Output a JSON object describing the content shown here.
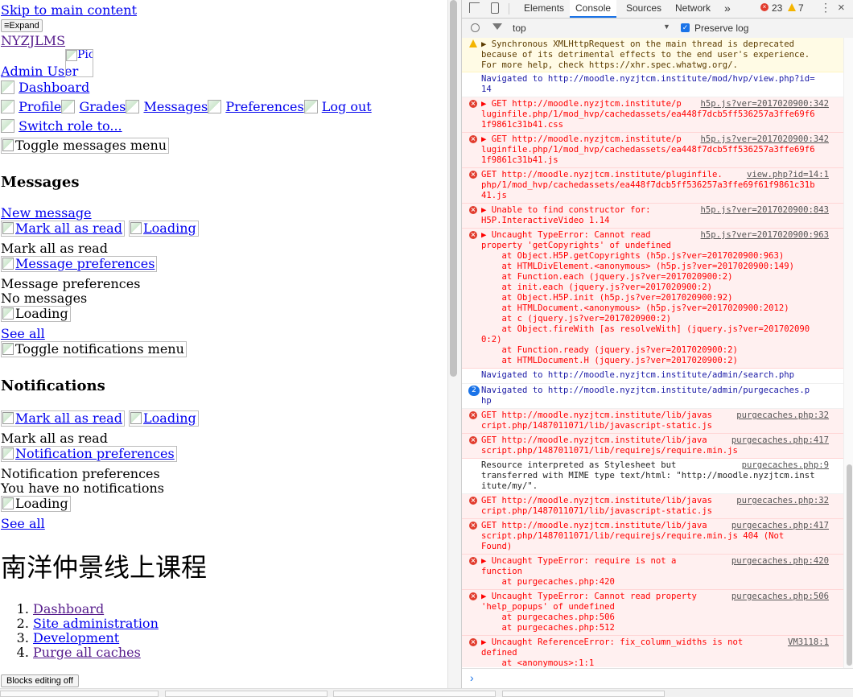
{
  "page": {
    "skip_link": "Skip to main content",
    "expand_button": "Expand",
    "site_name": "NYZJLMS",
    "user_name": "Admin User",
    "user_picture_alt": "Picture of",
    "nav": {
      "dashboard": "Dashboard",
      "profile": "Profile",
      "grades": "Grades",
      "messages": "Messages",
      "preferences": "Preferences",
      "logout": "Log out",
      "switch_role": "Switch role to..."
    },
    "toggle_messages": "Toggle messages menu",
    "messages": {
      "heading": "Messages",
      "new_message": "New message",
      "mark_all_read": "Mark all as read",
      "loading": "Loading",
      "mark_all_read_text": "Mark all as read",
      "message_preferences": "Message preferences",
      "message_preferences_text": "Message preferences",
      "no_messages": "No messages",
      "loading2": "Loading",
      "see_all": "See all"
    },
    "toggle_notifications": "Toggle notifications menu",
    "notifications": {
      "heading": "Notifications",
      "mark_all_read": "Mark all as read",
      "loading": "Loading",
      "mark_all_read_text": "Mark all as read",
      "notification_preferences": "Notification preferences",
      "notification_preferences_text": "Notification preferences",
      "no_notifications": "You have no notifications",
      "loading2": "Loading",
      "see_all": "See all"
    },
    "course_title": "南洋仲景线上课程",
    "breadcrumb": [
      "Dashboard",
      "Site administration",
      "Development",
      "Purge all caches"
    ],
    "blocks_editing": "Blocks editing off"
  },
  "devtools": {
    "tabs": [
      "Elements",
      "Console",
      "Sources",
      "Network"
    ],
    "more_tabs": "»",
    "error_count": "23",
    "warning_count": "7",
    "context": "top",
    "preserve_log": "Preserve log",
    "colors": {
      "accent": "#1a73e8",
      "error": "#ff0000",
      "error_bg": "#fff0f0",
      "warn_bg": "#fffbe5"
    },
    "messages": [
      {
        "kind": "warn",
        "text": "▶ Synchronous XMLHttpRequest on the main thread is deprecated\nbecause of its detrimental effects to the end user's experience.\nFor more help, check https://xhr.spec.whatwg.org/.",
        "src": ""
      },
      {
        "kind": "info",
        "text": "Navigated to http://moodle.nyzjtcm.institute/mod/hvp/view.php?id=\n14",
        "src": ""
      },
      {
        "kind": "err",
        "text": "▶ GET http://moodle.nyzjtcm.institute/p\nluginfile.php/1/mod_hvp/cachedassets/ea448f7dcb5ff536257a3ffe69f6\n1f9861c31b41.css",
        "src": "h5p.js?ver=2017020900:342"
      },
      {
        "kind": "err",
        "text": "▶ GET http://moodle.nyzjtcm.institute/p\nluginfile.php/1/mod_hvp/cachedassets/ea448f7dcb5ff536257a3ffe69f6\n1f9861c31b41.js",
        "src": "h5p.js?ver=2017020900:342"
      },
      {
        "kind": "err",
        "text": "GET http://moodle.nyzjtcm.institute/pluginfile.\nphp/1/mod_hvp/cachedassets/ea448f7dcb5ff536257a3ffe69f61f9861c31b\n41.js",
        "src": "view.php?id=14:1"
      },
      {
        "kind": "err",
        "text": "▶ Unable to find constructor for:\nH5P.InteractiveVideo 1.14",
        "src": "h5p.js?ver=2017020900:843"
      },
      {
        "kind": "err",
        "text": "▶ Uncaught TypeError: Cannot read\nproperty 'getCopyrights' of undefined\n    at Object.H5P.getCopyrights (h5p.js?ver=2017020900:963)\n    at HTMLDivElement.<anonymous> (h5p.js?ver=2017020900:149)\n    at Function.each (jquery.js?ver=2017020900:2)\n    at init.each (jquery.js?ver=2017020900:2)\n    at Object.H5P.init (h5p.js?ver=2017020900:92)\n    at HTMLDocument.<anonymous> (h5p.js?ver=2017020900:2012)\n    at c (jquery.js?ver=2017020900:2)\n    at Object.fireWith [as resolveWith] (jquery.js?ver=201702090\n0:2)\n    at Function.ready (jquery.js?ver=2017020900:2)\n    at HTMLDocument.H (jquery.js?ver=2017020900:2)",
        "src": "h5p.js?ver=2017020900:963"
      },
      {
        "kind": "info",
        "text": "Navigated to http://moodle.nyzjtcm.institute/admin/search.php",
        "src": ""
      },
      {
        "kind": "info",
        "count": "2",
        "text": "Navigated to http://moodle.nyzjtcm.institute/admin/purgecaches.p\nhp",
        "src": ""
      },
      {
        "kind": "err",
        "text": "GET http://moodle.nyzjtcm.institute/lib/javas\ncript.php/1487011071/lib/javascript-static.js",
        "src": "purgecaches.php:32"
      },
      {
        "kind": "err",
        "text": "GET http://moodle.nyzjtcm.institute/lib/java\nscript.php/1487011071/lib/requirejs/require.min.js",
        "src": "purgecaches.php:417"
      },
      {
        "kind": "plain",
        "text": "Resource interpreted as Stylesheet but\ntransferred with MIME type text/html: \"http://moodle.nyzjtcm.inst\nitute/my/\".",
        "src": "purgecaches.php:9"
      },
      {
        "kind": "err",
        "text": "GET http://moodle.nyzjtcm.institute/lib/javas\ncript.php/1487011071/lib/javascript-static.js",
        "src": "purgecaches.php:32"
      },
      {
        "kind": "err",
        "text": "GET http://moodle.nyzjtcm.institute/lib/java\nscript.php/1487011071/lib/requirejs/require.min.js 404 (Not\nFound)",
        "src": "purgecaches.php:417"
      },
      {
        "kind": "err",
        "text": "▶ Uncaught TypeError: require is not a\nfunction\n    at purgecaches.php:420",
        "src": "purgecaches.php:420"
      },
      {
        "kind": "err",
        "text": "▶ Uncaught TypeError: Cannot read property\n'help_popups' of undefined\n    at purgecaches.php:506\n    at purgecaches.php:512",
        "src": "purgecaches.php:506"
      },
      {
        "kind": "err",
        "text": "▶ Uncaught ReferenceError: fix_column_widths is not\ndefined\n    at <anonymous>:1:1",
        "src": "VM3118:1"
      }
    ],
    "prompt_symbol": "›"
  }
}
